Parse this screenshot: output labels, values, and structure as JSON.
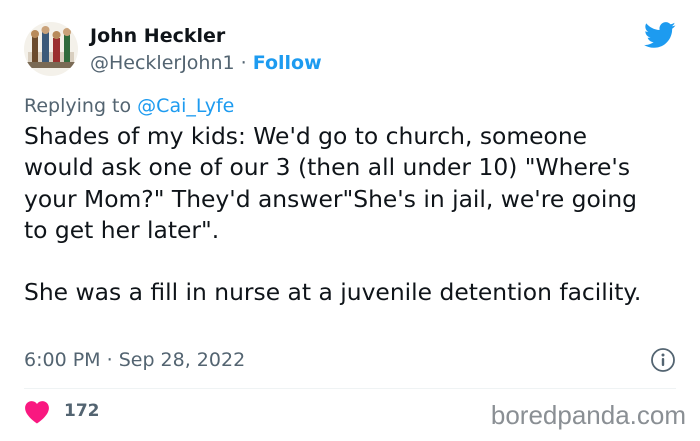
{
  "author": {
    "display_name": "John Heckler",
    "handle": "@HecklerJohn1",
    "separator": "·",
    "follow_label": "Follow"
  },
  "reply": {
    "prefix": "Replying to",
    "mention": "@Cai_Lyfe"
  },
  "tweet": {
    "paragraph_1": "Shades of my kids: We'd go to church, someone would ask one of our 3 (then all under 10) \"Where's your Mom?\" They'd answer\"She's in jail, we're going to get her later\".",
    "paragraph_2": "She was a fill in nurse at a juvenile detention facility."
  },
  "meta": {
    "time": "6:00 PM",
    "separator": "·",
    "date": "Sep 28, 2022"
  },
  "engagement": {
    "likes": "172"
  },
  "watermark": "boredpanda.com",
  "colors": {
    "accent": "#1d9bf0",
    "heart": "#f91880",
    "muted_text": "#536471",
    "text": "#0f1419"
  },
  "icons": {
    "brand": "twitter-bird-icon",
    "info": "info-icon",
    "like": "heart-icon"
  }
}
